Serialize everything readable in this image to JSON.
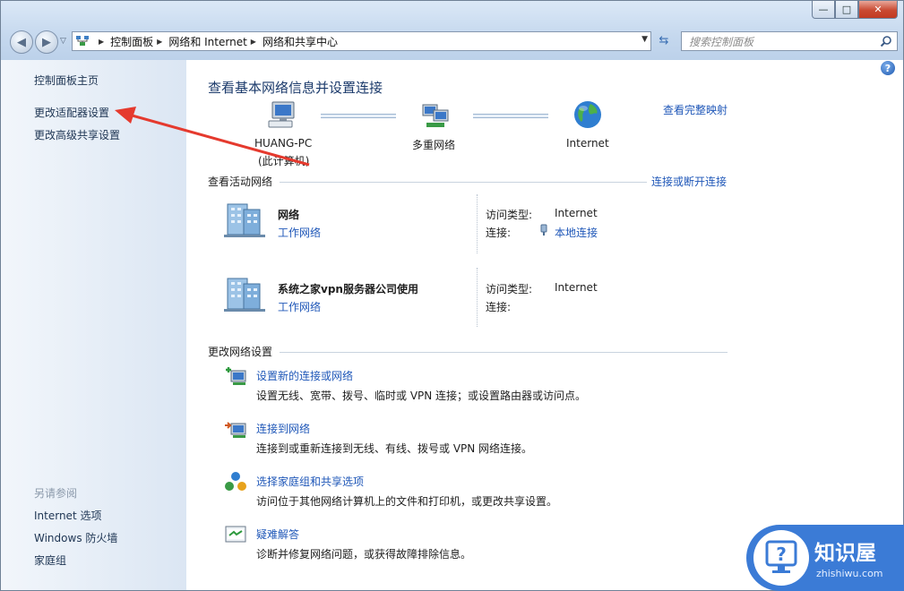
{
  "window": {
    "caption": {
      "minimize": "—",
      "maximize": "□",
      "close": "✕"
    }
  },
  "nav": {
    "back": "◀",
    "forward": "▶",
    "history_dropdown": "▽",
    "refresh": "⇆"
  },
  "address": {
    "breadcrumbs": [
      "控制面板",
      "网络和 Internet",
      "网络和共享中心"
    ],
    "dropdown": "▼"
  },
  "search": {
    "placeholder": "搜索控制面板"
  },
  "sidebar": {
    "top_links": [
      "控制面板主页",
      "更改适配器设置",
      "更改高级共享设置"
    ],
    "see_also_title": "另请参阅",
    "see_also_links": [
      "Internet 选项",
      "Windows 防火墙",
      "家庭组"
    ]
  },
  "main": {
    "help": "?",
    "heading": "查看基本网络信息并设置连接",
    "full_map_link": "查看完整映射",
    "map": {
      "computer": {
        "name": "HUANG-PC",
        "note": "(此计算机)"
      },
      "network": {
        "name": "多重网络"
      },
      "internet": {
        "name": "Internet"
      }
    },
    "active_section": {
      "title": "查看活动网络",
      "connect_link": "连接或断开连接",
      "networks": [
        {
          "name": "网络",
          "type_link": "工作网络",
          "access_label": "访问类型:",
          "access_value": "Internet",
          "conn_label": "连接:",
          "conn_value": "本地连接"
        },
        {
          "name": "系统之家vpn服务器公司使用",
          "type_link": "工作网络",
          "access_label": "访问类型:",
          "access_value": "Internet",
          "conn_label": "连接:",
          "conn_value": ""
        }
      ]
    },
    "change_section": {
      "title": "更改网络设置",
      "tasks": [
        {
          "icon": "new-connection-icon",
          "link": "设置新的连接或网络",
          "desc": "设置无线、宽带、拨号、临时或 VPN 连接；或设置路由器或访问点。"
        },
        {
          "icon": "connect-network-icon",
          "link": "连接到网络",
          "desc": "连接到或重新连接到无线、有线、拨号或 VPN 网络连接。"
        },
        {
          "icon": "homegroup-icon",
          "link": "选择家庭组和共享选项",
          "desc": "访问位于其他网络计算机上的文件和打印机，或更改共享设置。"
        },
        {
          "icon": "troubleshoot-icon",
          "link": "疑难解答",
          "desc": "诊断并修复网络问题，或获得故障排除信息。"
        }
      ]
    }
  },
  "watermark": {
    "title": "知识屋",
    "subtitle": "zhishiwu.com"
  },
  "colors": {
    "link": "#1f57b8",
    "heading": "#1b3a6b",
    "arrow": "#e53a2e",
    "watermark": "#3b7bd6"
  }
}
